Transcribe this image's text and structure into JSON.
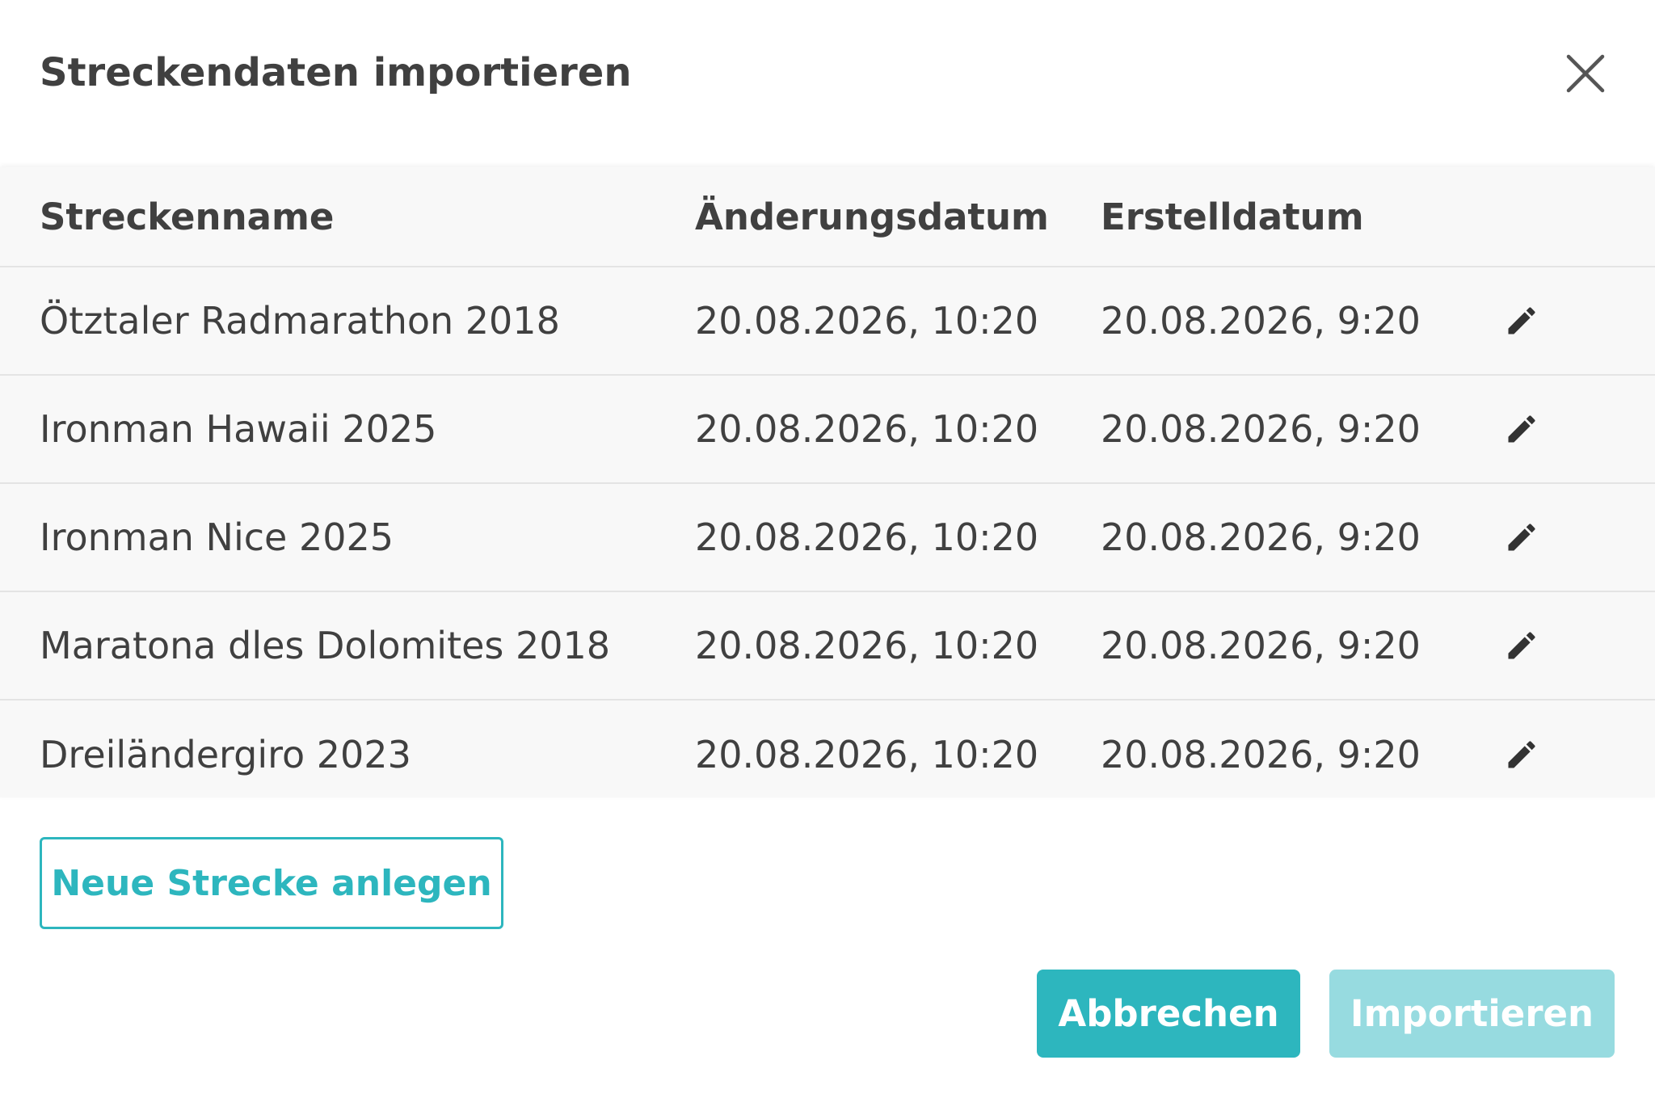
{
  "dialog": {
    "title": "Streckendaten importieren",
    "close_icon": "close-icon"
  },
  "table": {
    "headers": {
      "name": "Streckenname",
      "modified": "Änderungsdatum",
      "created": "Erstelldatum"
    },
    "rows": [
      {
        "name": "Ötztaler Radmarathon 2018",
        "modified": "20.08.2026, 10:20",
        "created": "20.08.2026, 9:20",
        "action_icon": "pencil-icon"
      },
      {
        "name": "Ironman Hawaii 2025",
        "modified": "20.08.2026, 10:20",
        "created": "20.08.2026, 9:20",
        "action_icon": "pencil-icon"
      },
      {
        "name": "Ironman Nice 2025",
        "modified": "20.08.2026, 10:20",
        "created": "20.08.2026, 9:20",
        "action_icon": "pencil-icon"
      },
      {
        "name": "Maratona dles Dolomites 2018",
        "modified": "20.08.2026, 10:20",
        "created": "20.08.2026, 9:20",
        "action_icon": "pencil-icon"
      },
      {
        "name": "Dreiländergiro 2023",
        "modified": "20.08.2026, 10:20",
        "created": "20.08.2026, 9:20",
        "action_icon": "pencil-icon"
      }
    ]
  },
  "actions": {
    "new_route_label": "Neue Strecke anlegen",
    "cancel_label": "Abbrechen",
    "import_label": "Importieren",
    "import_enabled": false
  },
  "colors": {
    "accent": "#2db6be",
    "accent_disabled": "#97dbe0",
    "text": "#404040",
    "table_background": "#f8f8f8",
    "divider": "#e4e4e4"
  }
}
